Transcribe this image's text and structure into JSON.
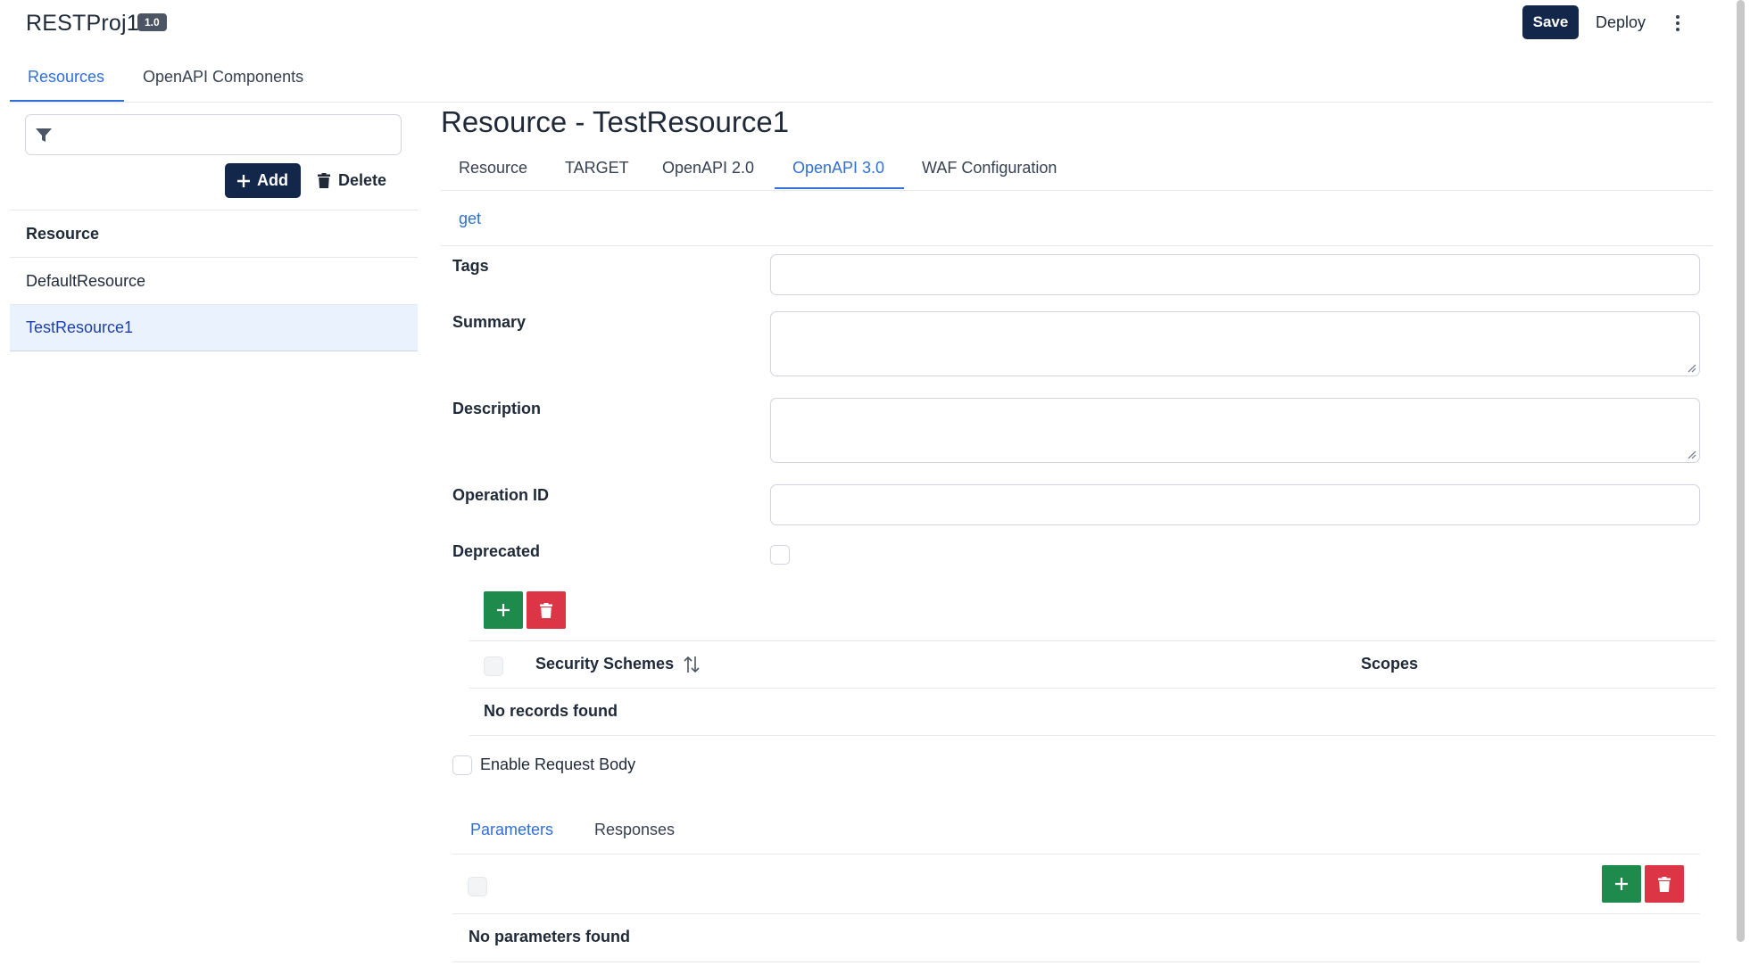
{
  "header": {
    "app_title": "RESTProj1",
    "version": "1.0",
    "save_label": "Save",
    "deploy_label": "Deploy",
    "more_icon": "kebab-vertical-icon"
  },
  "top_tabs": [
    {
      "label": "Resources",
      "active": true
    },
    {
      "label": "OpenAPI Components",
      "active": false
    }
  ],
  "left_panel": {
    "filter_placeholder": "",
    "add_label": "Add",
    "delete_label": "Delete",
    "list_header": "Resource",
    "items": [
      {
        "label": "DefaultResource",
        "selected": false
      },
      {
        "label": "TestResource1",
        "selected": true
      }
    ]
  },
  "main": {
    "title": "Resource - TestResource1",
    "tabs": [
      {
        "label": "Resource",
        "active": false
      },
      {
        "label": "TARGET",
        "active": false
      },
      {
        "label": "OpenAPI 2.0",
        "active": false
      },
      {
        "label": "OpenAPI 3.0",
        "active": true
      },
      {
        "label": "WAF Configuration",
        "active": false
      }
    ],
    "method_tab": "get",
    "fields": {
      "tags_label": "Tags",
      "tags_value": "",
      "summary_label": "Summary",
      "summary_value": "",
      "description_label": "Description",
      "description_value": "",
      "operation_id_label": "Operation ID",
      "operation_id_value": "",
      "deprecated_label": "Deprecated",
      "deprecated_checked": false
    },
    "security_table": {
      "col_schemes": "Security Schemes",
      "col_scopes": "Scopes",
      "empty_message": "No records found"
    },
    "enable_request_body_label": "Enable Request Body",
    "enable_request_body_checked": false,
    "bottom_tabs": [
      {
        "label": "Parameters",
        "active": true
      },
      {
        "label": "Responses",
        "active": false
      }
    ],
    "parameters_empty_message": "No parameters found"
  },
  "colors": {
    "primary_dark": "#13274a",
    "accent_blue": "#2f6fd6",
    "success_green": "#1e8a4c",
    "danger_red": "#dc3545",
    "selected_row_bg": "#eaf2fe"
  }
}
